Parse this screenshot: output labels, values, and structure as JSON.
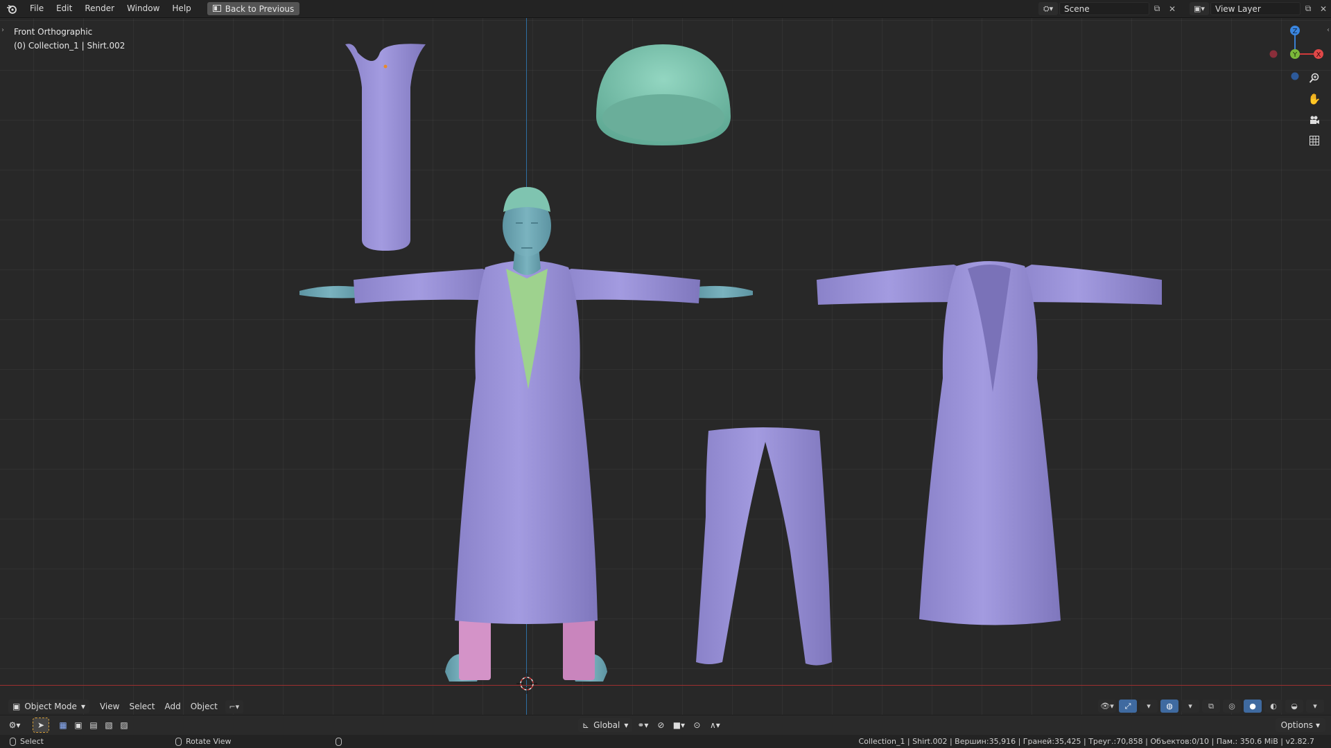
{
  "topbar": {
    "menus": [
      "File",
      "Edit",
      "Render",
      "Window",
      "Help"
    ],
    "back_button": "Back to Previous",
    "scene": "Scene",
    "view_layer": "View Layer"
  },
  "viewport": {
    "view_name": "Front Orthographic",
    "active_object": "(0) Collection_1 | Shirt.002",
    "gizmo": {
      "z": "Z",
      "y": "Y",
      "x": "X"
    }
  },
  "header": {
    "mode": "Object Mode",
    "menus": [
      "View",
      "Select",
      "Add",
      "Object"
    ]
  },
  "toolbar": {
    "orientation": "Global",
    "options": "Options"
  },
  "statusbar": {
    "left_action": "Select",
    "middle_action": "Rotate View",
    "stats": "Collection_1 | Shirt.002 | Вершин:35,916 | Граней:35,425 | Треуг.:70,858 | Объектов:0/10 | Пам.: 350.6 MiB | v2.82.7"
  },
  "colors": {
    "garment": "#9b93d6",
    "garment_dark": "#7f77bd",
    "skin": "#6fa6b2",
    "hat": "#7fc4b0",
    "undershirt": "#9ed28e",
    "pants": "#d493c8",
    "accent": "#3f6aa0"
  },
  "icons": [
    "blender-logo-icon",
    "back-icon",
    "scene-icon",
    "view-layer-icon",
    "zoom-icon",
    "hand-icon",
    "camera-icon",
    "grid-icon"
  ]
}
